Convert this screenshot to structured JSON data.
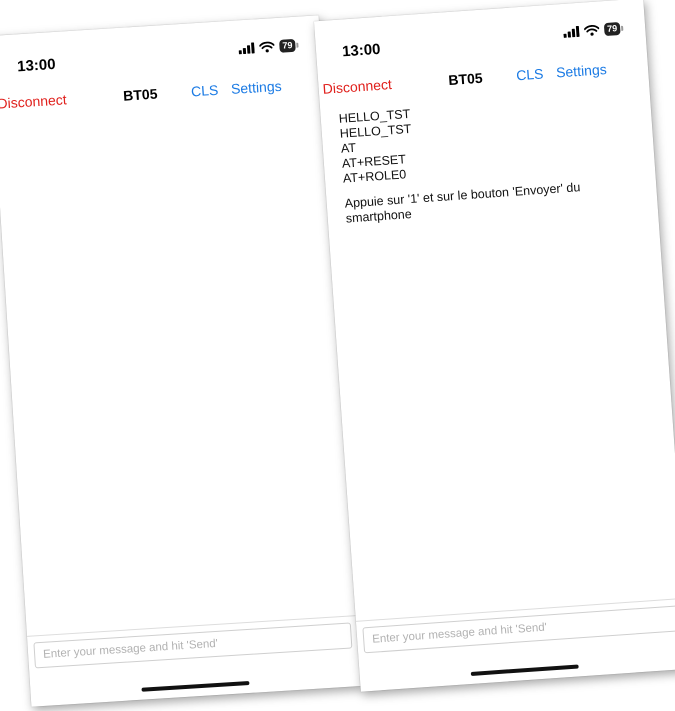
{
  "screens": [
    {
      "status": {
        "time": "13:00",
        "battery": "79"
      },
      "nav": {
        "disconnect_label": "Disconnect",
        "title": "BT05",
        "cls_label": "CLS",
        "settings_label": "Settings"
      },
      "terminal": {
        "lines": [],
        "message": ""
      },
      "input": {
        "placeholder": "Enter your message and hit 'Send'",
        "value": ""
      }
    },
    {
      "status": {
        "time": "13:00",
        "battery": "79"
      },
      "nav": {
        "disconnect_label": "Disconnect",
        "title": "BT05",
        "cls_label": "CLS",
        "settings_label": "Settings"
      },
      "terminal": {
        "lines": [
          "HELLO_TST",
          "HELLO_TST",
          "AT",
          "AT+RESET",
          "AT+ROLE0"
        ],
        "message": "Appuie sur '1' et sur le bouton 'Envoyer' du smartphone"
      },
      "input": {
        "placeholder": "Enter your message and hit 'Send'",
        "value": ""
      }
    }
  ],
  "colors": {
    "disconnect": "#e0201c",
    "link": "#1a7ae4",
    "text": "#111111"
  },
  "icons": [
    "signal-bars-icon",
    "wifi-icon",
    "battery-icon"
  ]
}
